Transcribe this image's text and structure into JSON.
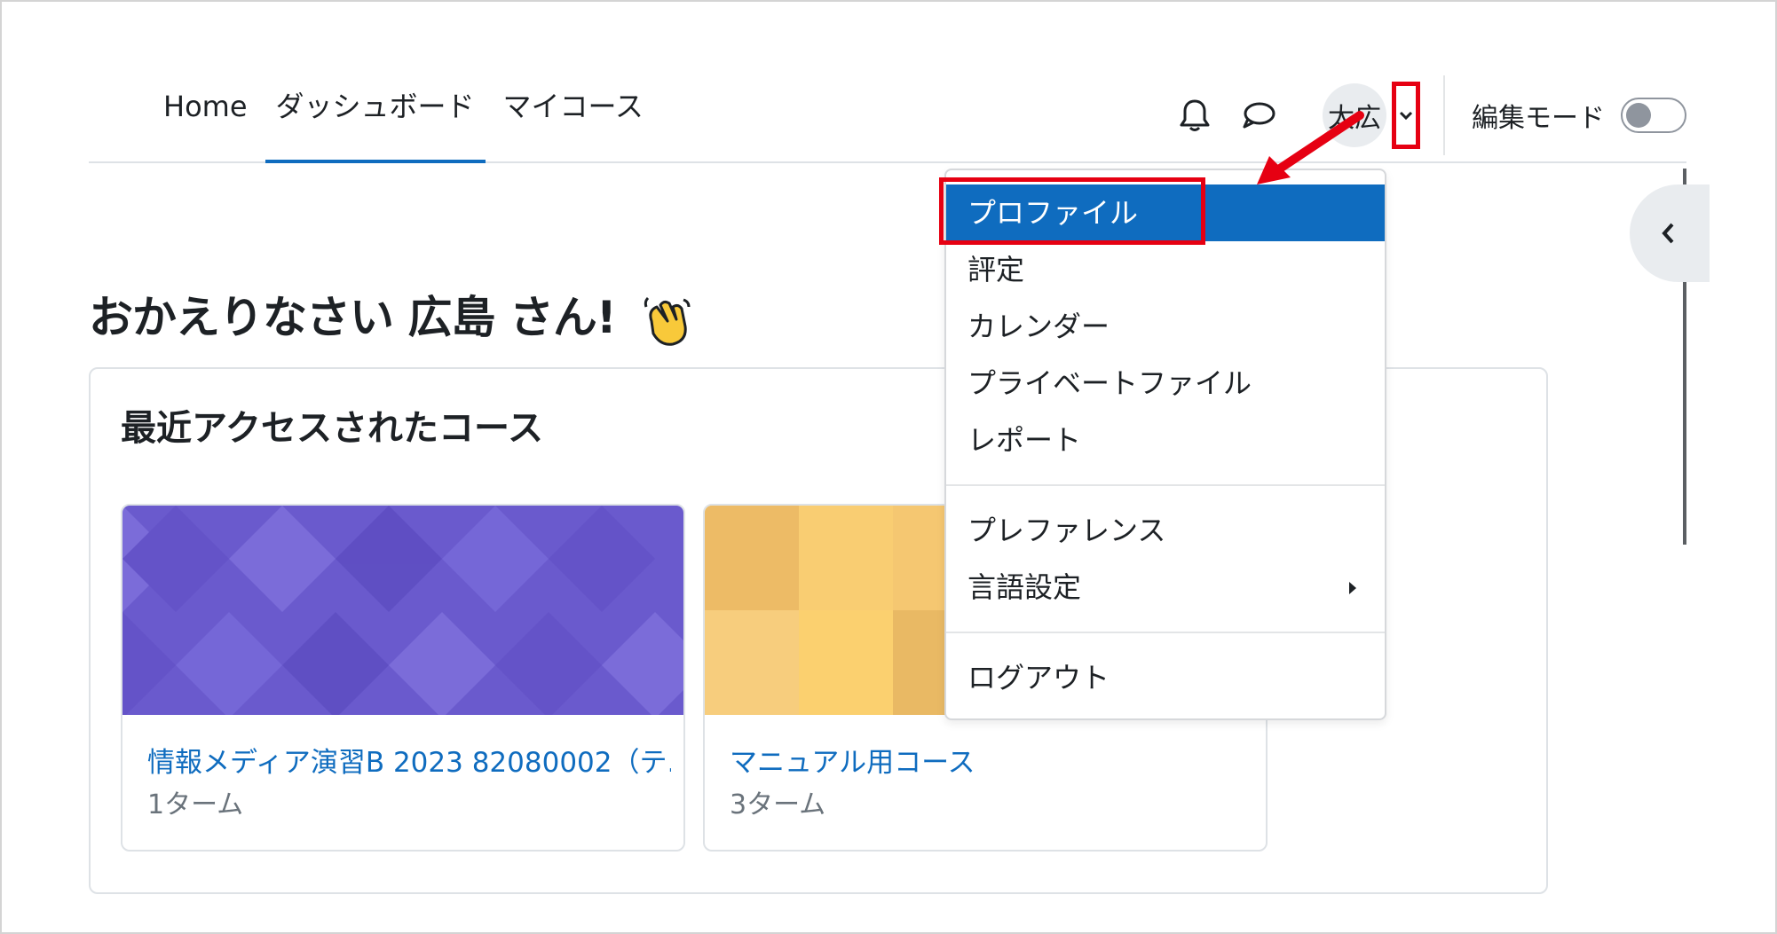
{
  "nav": {
    "home": "Home",
    "dashboard": "ダッシュボード",
    "mycourses": "マイコース"
  },
  "user": {
    "avatar_initials": "太広",
    "edit_mode_label": "編集モード",
    "edit_mode_on": false
  },
  "icons": {
    "notifications": "bell-icon",
    "messages": "chat-bubble-icon",
    "user_menu": "chevron-down-icon",
    "drawer": "chevron-left-icon",
    "submenu": "caret-right-icon"
  },
  "welcome": {
    "text": "おかえりなさい 広島 さん!"
  },
  "recent": {
    "title": "最近アクセスされたコース",
    "courses": [
      {
        "name": "情報メディア演習B 2023 82080002（テ...",
        "term": "1ターム"
      },
      {
        "name": "マニュアル用コース",
        "term": "3ターム"
      }
    ]
  },
  "menu": {
    "items": [
      {
        "label": "プロファイル"
      },
      {
        "label": "評定"
      },
      {
        "label": "カレンダー"
      },
      {
        "label": "プライベートファイル"
      },
      {
        "label": "レポート"
      }
    ],
    "items2": [
      {
        "label": "プレファレンス"
      },
      {
        "label": "言語設定"
      }
    ],
    "items3": [
      {
        "label": "ログアウト"
      }
    ]
  },
  "colors": {
    "accent": "#0f6cbf",
    "highlight": "#e60012"
  }
}
